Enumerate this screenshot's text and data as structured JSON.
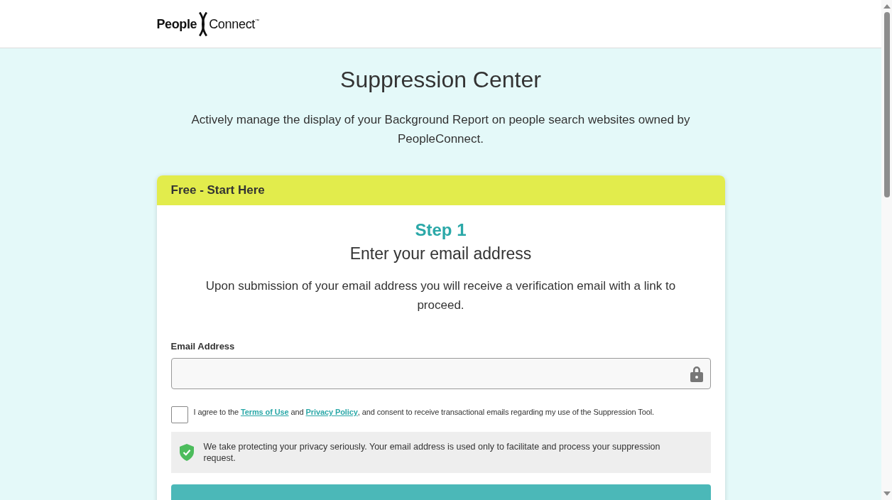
{
  "header": {
    "logo": {
      "word_left": "People",
      "word_right": "Connect",
      "trademark": "™"
    }
  },
  "hero": {
    "title": "Suppression Center",
    "description": "Actively manage the display of your Background Report on people search websites owned by PeopleConnect."
  },
  "card": {
    "header": "Free - Start Here",
    "step": "Step 1",
    "heading": "Enter your email address",
    "description": "Upon submission of your email address you will receive a verification email with a link to proceed.",
    "email_field": {
      "label": "Email Address"
    },
    "consent": {
      "checked": false,
      "parts": [
        {
          "kind": "text",
          "text": "I agree to the "
        },
        {
          "kind": "link",
          "text": "Terms of Use"
        },
        {
          "kind": "text",
          "text": " and "
        },
        {
          "kind": "link",
          "text": "Privacy Policy"
        },
        {
          "kind": "text",
          "text": ", and consent to receive transactional emails regarding my use of the Suppression Tool."
        }
      ]
    },
    "privacy_note": "We take protecting your privacy seriously. Your email address is used only to facilitate and process your suppression request."
  }
}
